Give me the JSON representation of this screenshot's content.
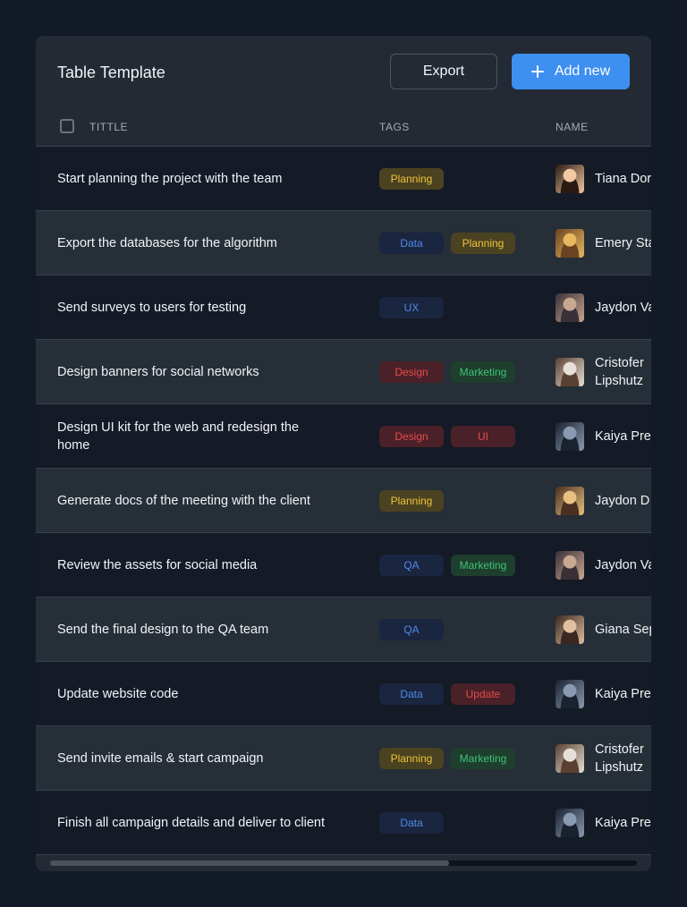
{
  "card": {
    "title": "Table Template",
    "export_label": "Export",
    "add_label": "Add new"
  },
  "table": {
    "columns": [
      "TITTLE",
      "TAGS",
      "NAME"
    ],
    "rows": [
      {
        "title": "Start planning the project with the team",
        "tags": [
          "Planning"
        ],
        "name": "Tiana Dor"
      },
      {
        "title": "Export the databases for the algorithm",
        "tags": [
          "Data",
          "Planning"
        ],
        "name": "Emery Sta"
      },
      {
        "title": "Send surveys to users for testing",
        "tags": [
          "UX"
        ],
        "name": "Jaydon Va"
      },
      {
        "title": "Design banners for social networks",
        "tags": [
          "Design",
          "Marketing"
        ],
        "name": "Cristofer\nLipshutz"
      },
      {
        "title": "Design UI kit for the web and redesign the home",
        "tags": [
          "Design",
          "UI"
        ],
        "name": "Kaiya Pre"
      },
      {
        "title": "Generate docs of the meeting with the client",
        "tags": [
          "Planning"
        ],
        "name": "Jaydon D"
      },
      {
        "title": "Review the assets for social media",
        "tags": [
          "QA",
          "Marketing"
        ],
        "name": "Jaydon Va"
      },
      {
        "title": "Send the final design to the QA team",
        "tags": [
          "QA"
        ],
        "name": "Giana Sep"
      },
      {
        "title": "Update website code",
        "tags": [
          "Data",
          "Update"
        ],
        "name": "Kaiya Pre"
      },
      {
        "title": "Send invite emails & start campaign",
        "tags": [
          "Planning",
          "Marketing"
        ],
        "name": "Cristofer\nLipshutz"
      },
      {
        "title": "Finish all campaign details and deliver to client",
        "tags": [
          "Data"
        ],
        "name": "Kaiya Pre"
      }
    ]
  },
  "colors": {
    "background": "#121a28",
    "card": "#232a33",
    "accent": "#3d8ff0",
    "tag_planning": "#f0c33a",
    "tag_data": "#4d8ce8",
    "tag_red": "#e84a4a",
    "tag_marketing": "#3dc373"
  },
  "scrollbar": {
    "horizontal_position": 0.68
  }
}
